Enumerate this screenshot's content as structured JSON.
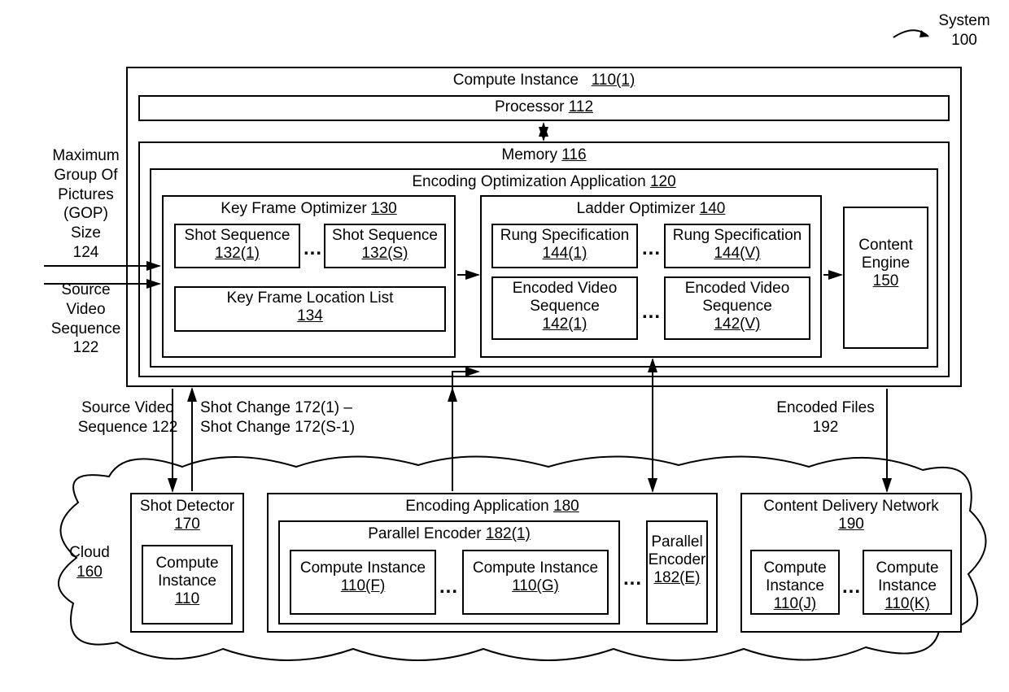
{
  "system": {
    "label": "System",
    "num": "100"
  },
  "compute_instance_1": {
    "label": "Compute Instance",
    "num": "110(1)"
  },
  "processor": {
    "label": "Processor",
    "num": "112"
  },
  "memory": {
    "label": "Memory",
    "num": "116"
  },
  "encoding_opt_app": {
    "label": "Encoding Optimization Application",
    "num": "120"
  },
  "kf_optimizer": {
    "label": "Key Frame Optimizer",
    "num": "130"
  },
  "shot_seq_1": {
    "label": "Shot Sequence",
    "num": "132(1)"
  },
  "shot_seq_s": {
    "label": "Shot Sequence",
    "num": "132(S)"
  },
  "kf_loc_list": {
    "label": "Key Frame Location List",
    "num": "134"
  },
  "ladder_opt": {
    "label": "Ladder Optimizer",
    "num": "140"
  },
  "rung_spec_1": {
    "label": "Rung Specification",
    "num": "144(1)"
  },
  "rung_spec_v": {
    "label": "Rung Specification",
    "num": "144(V)"
  },
  "enc_vid_seq_1": {
    "label": "Encoded Video Sequence",
    "num": "142(1)"
  },
  "enc_vid_seq_v": {
    "label": "Encoded Video Sequence",
    "num": "142(V)"
  },
  "content_engine": {
    "label": "Content Engine",
    "num": "150"
  },
  "max_gop": {
    "l1": "Maximum",
    "l2": "Group Of",
    "l3": "Pictures",
    "l4": "(GOP)",
    "l5": "Size",
    "num": "124"
  },
  "src_vid_seq_left": {
    "l1": "Source",
    "l2": "Video",
    "l3": "Sequence",
    "num": "122"
  },
  "src_vid_bottom": {
    "label": "Source Video Sequence",
    "num": "122"
  },
  "shot_change": {
    "l1": "Shot Change 172(1) –",
    "l2": "Shot Change 172(S-1)"
  },
  "encoded_files": {
    "label": "Encoded Files",
    "num": "192"
  },
  "cloud": {
    "label": "Cloud",
    "num": "160"
  },
  "shot_detector": {
    "label": "Shot Detector",
    "num": "170"
  },
  "ci_sd": {
    "label": "Compute Instance",
    "num": "110"
  },
  "encoding_app": {
    "label": "Encoding Application",
    "num": "180"
  },
  "parallel_enc_1": {
    "label": "Parallel Encoder",
    "num": "182(1)"
  },
  "ci_f": {
    "label": "Compute Instance",
    "num": "110(F)"
  },
  "ci_g": {
    "label": "Compute Instance",
    "num": "110(G)"
  },
  "parallel_enc_e": {
    "l1": "Parallel",
    "l2": "Encoder",
    "num": "182(E)"
  },
  "cdn": {
    "label": "Content Delivery Network",
    "num": "190"
  },
  "ci_j": {
    "label": "Compute Instance",
    "num": "110(J)"
  },
  "ci_k": {
    "label": "Compute Instance",
    "num": "110(K)"
  },
  "ellipsis": "..."
}
